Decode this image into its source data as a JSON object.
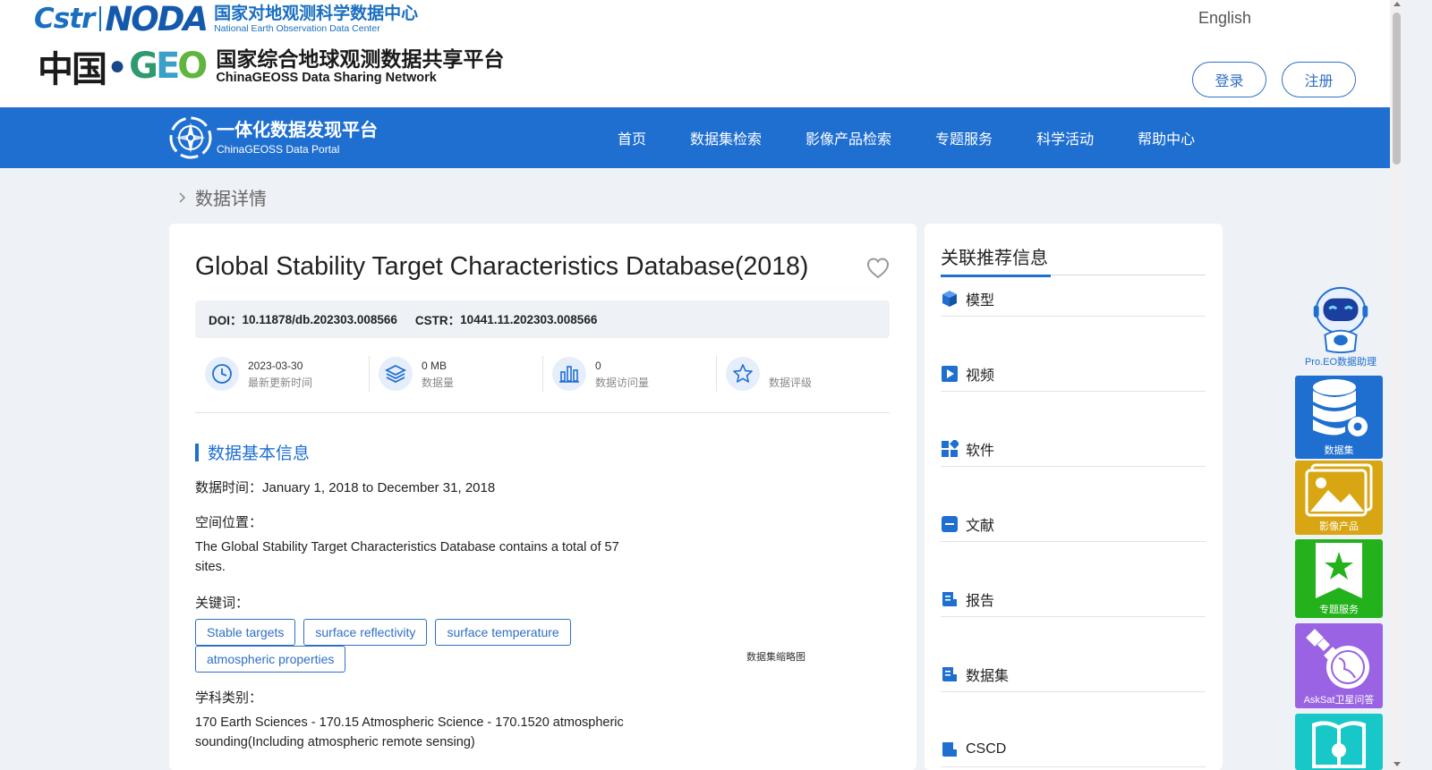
{
  "header": {
    "noda_logo_left": "Cstr",
    "noda_logo_right": "NODA",
    "noda_cn": "国家对地观测科学数据中心",
    "noda_en": "National Earth Observation Data Center",
    "china_text": "中国",
    "geo_text_g": "G",
    "geo_text_e": "E",
    "geo_text_o": "O",
    "geoss_cn": "国家综合地球观测数据共享平台",
    "geoss_en": "ChinaGEOSS Data Sharing Network",
    "language_link": "English",
    "login_label": "登录",
    "register_label": "注册"
  },
  "nav": {
    "portal_cn": "一体化数据发现平台",
    "portal_en": "ChinaGEOSS Data Portal",
    "items": [
      "首页",
      "数据集检索",
      "影像产品检索",
      "专题服务",
      "科学活动",
      "帮助中心"
    ]
  },
  "breadcrumb": {
    "current": "数据详情"
  },
  "dataset": {
    "title": "Global Stability Target Characteristics Database(2018)",
    "doi_label": "DOI：",
    "doi_value": "10.11878/db.202303.008566",
    "cstr_label": "CSTR：",
    "cstr_value": "10441.11.202303.008566",
    "stats": [
      {
        "value": "2023-03-30",
        "label": "最新更新时间",
        "icon": "clock-icon"
      },
      {
        "value": "0 MB",
        "label": "数据量",
        "icon": "layers-icon"
      },
      {
        "value": "0",
        "label": "数据访问量",
        "icon": "bar-chart-icon"
      },
      {
        "value": "",
        "label": "数据评级",
        "icon": "star-icon"
      }
    ],
    "section_title": "数据基本信息",
    "time_label": "数据时间：",
    "time_value": "January 1, 2018 to December 31, 2018",
    "space_label": "空间位置：",
    "space_value": "The Global Stability Target Characteristics Database contains a total of 57 sites.",
    "keywords_label": "关键词：",
    "keywords": [
      "Stable targets",
      "surface reflectivity",
      "surface temperature",
      "atmospheric properties"
    ],
    "thumbnail_label": "数据集缩略图",
    "subject_label": "学科类别：",
    "subject_value": "170 Earth Sciences - 170.15 Atmospheric Science - 170.1520 atmospheric sounding(Including atmospheric remote sensing)"
  },
  "related": {
    "title": "关联推荐信息",
    "items": [
      {
        "label": "模型",
        "icon": "cube-icon"
      },
      {
        "label": "视频",
        "icon": "play-icon"
      },
      {
        "label": "软件",
        "icon": "apps-icon"
      },
      {
        "label": "文献",
        "icon": "doc-icon"
      },
      {
        "label": "报告",
        "icon": "report-icon"
      },
      {
        "label": "数据集",
        "icon": "dataset-icon"
      },
      {
        "label": "CSCD",
        "icon": "cscd-icon"
      }
    ]
  },
  "tools": {
    "assistant_label": "Pro.EO数据助理",
    "dataset_label": "数据集",
    "image_label": "影像产品",
    "topic_label": "专题服务",
    "asksat_label": "AskSat卫星问答"
  },
  "colors": {
    "primary": "#1f6fd1",
    "tool_dataset": "#1f6fd1",
    "tool_image": "#d9a613",
    "tool_topic": "#23b21c",
    "tool_asksat": "#9a63e3",
    "tool_teal": "#18c8c8"
  }
}
